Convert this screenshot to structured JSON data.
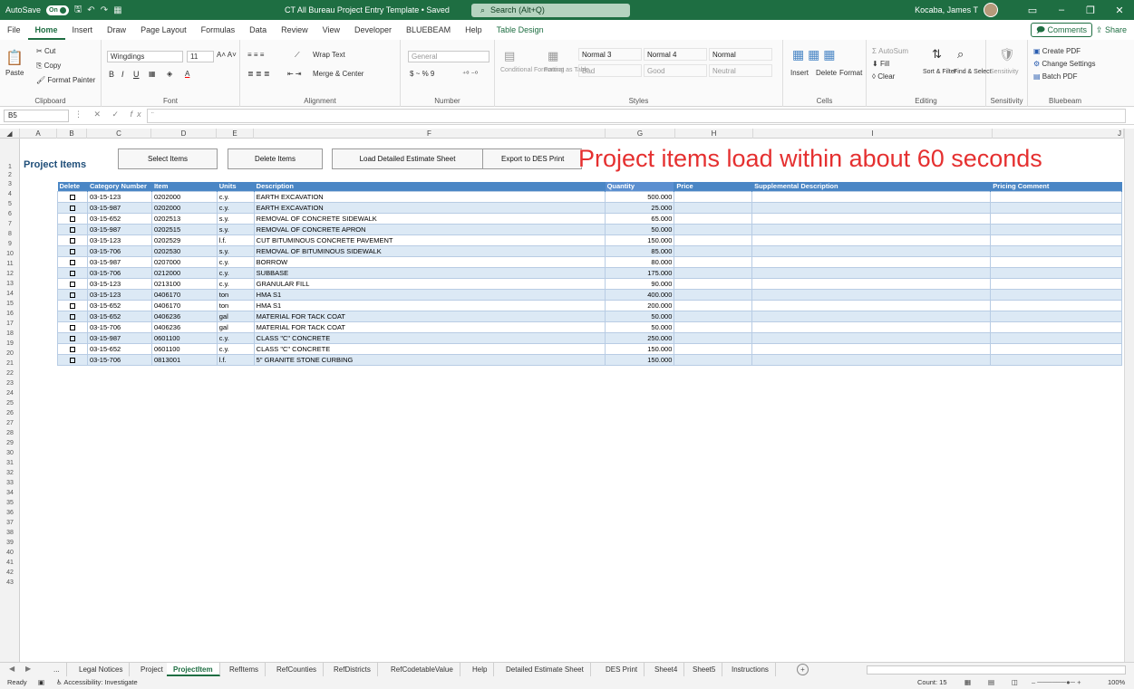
{
  "window": {
    "autosave_label": "AutoSave",
    "autosave_state": "On",
    "doc_title": "CT All Bureau Project Entry Template • Saved",
    "search_placeholder": "Search (Alt+Q)",
    "user_name": "Kocaba, James T",
    "minimize": "–",
    "restore": "❐",
    "close": "✕"
  },
  "menu": {
    "tabs": [
      "File",
      "Home",
      "Insert",
      "Draw",
      "Page Layout",
      "Formulas",
      "Data",
      "Review",
      "View",
      "Developer",
      "BLUEBEAM",
      "Help",
      "Table Design"
    ],
    "comments": "Comments",
    "share": "Share"
  },
  "ribbon": {
    "clipboard": {
      "label": "Clipboard",
      "paste": "Paste",
      "cut": "Cut",
      "copy": "Copy",
      "format_painter": "Format Painter"
    },
    "font": {
      "label": "Font",
      "name": "Wingdings",
      "size": "11"
    },
    "alignment": {
      "label": "Alignment",
      "wrap": "Wrap Text",
      "merge": "Merge & Center"
    },
    "number": {
      "label": "Number",
      "format": "General",
      "currency": "$ ~ % 9"
    },
    "styles": {
      "label": "Styles",
      "conditional": "Conditional Formatting",
      "format_as": "Format as Table",
      "items": [
        "Normal 3",
        "Normal 4",
        "Normal",
        "Bad",
        "Good",
        "Neutral"
      ]
    },
    "cells": {
      "label": "Cells",
      "insert": "Insert",
      "delete": "Delete",
      "format": "Format"
    },
    "editing": {
      "label": "Editing",
      "autosum": "AutoSum",
      "fill": "Fill",
      "clear": "Clear",
      "sort": "Sort & Filter",
      "find": "Find & Select"
    },
    "sensitivity": {
      "label": "Sensitivity",
      "btn": "Sensitivity"
    },
    "bluebeam": {
      "label": "Bluebeam",
      "create_pdf": "Create PDF",
      "change_settings": "Change Settings",
      "batch_pdf": "Batch PDF"
    }
  },
  "formula_bar": {
    "name_box": "B5",
    "fx": "fx",
    "content": "¨"
  },
  "columns": [
    "A",
    "B",
    "C",
    "D",
    "E",
    "F",
    "G",
    "H",
    "I",
    "J"
  ],
  "rows": [
    "1",
    "2",
    "3",
    "4",
    "5",
    "6",
    "7",
    "8",
    "9",
    "10",
    "11",
    "12",
    "13",
    "14",
    "15",
    "16",
    "17",
    "18",
    "19",
    "20",
    "21",
    "22",
    "23",
    "24",
    "25",
    "26",
    "27",
    "28",
    "29",
    "30",
    "31",
    "32",
    "33",
    "34",
    "35",
    "36",
    "37",
    "38",
    "39",
    "40",
    "41",
    "42",
    "43"
  ],
  "sheet": {
    "heading": "Project Items",
    "buttons": {
      "select_items": "Select Items",
      "delete_items": "Delete Items",
      "load_estimate": "Load Detailed Estimate Sheet",
      "export_des": "Export to DES Print"
    },
    "overlay_note": "Project items load within about 60 seconds",
    "table": {
      "headers": [
        "Delete",
        "Category Number",
        "Item",
        "Units",
        "Description",
        "Quantity",
        "Price",
        "Supplemental Description",
        "Pricing Comment"
      ],
      "rows": [
        [
          "03-15-123",
          "0202000",
          "c.y.",
          "EARTH EXCAVATION",
          "500.000"
        ],
        [
          "03-15-987",
          "0202000",
          "c.y.",
          "EARTH EXCAVATION",
          "25.000"
        ],
        [
          "03-15-652",
          "0202513",
          "s.y.",
          "REMOVAL OF CONCRETE SIDEWALK",
          "65.000"
        ],
        [
          "03-15-987",
          "0202515",
          "s.y.",
          "REMOVAL OF CONCRETE APRON",
          "50.000"
        ],
        [
          "03-15-123",
          "0202529",
          "l.f.",
          "CUT BITUMINOUS CONCRETE PAVEMENT",
          "150.000"
        ],
        [
          "03-15-706",
          "0202530",
          "s.y.",
          "REMOVAL OF BITUMINOUS SIDEWALK",
          "85.000"
        ],
        [
          "03-15-987",
          "0207000",
          "c.y.",
          "BORROW",
          "80.000"
        ],
        [
          "03-15-706",
          "0212000",
          "c.y.",
          "SUBBASE",
          "175.000"
        ],
        [
          "03-15-123",
          "0213100",
          "c.y.",
          "GRANULAR FILL",
          "90.000"
        ],
        [
          "03-15-123",
          "0406170",
          "ton",
          "HMA S1",
          "400.000"
        ],
        [
          "03-15-652",
          "0406170",
          "ton",
          "HMA S1",
          "200.000"
        ],
        [
          "03-15-652",
          "0406236",
          "gal",
          "MATERIAL FOR TACK COAT",
          "50.000"
        ],
        [
          "03-15-706",
          "0406236",
          "gal",
          "MATERIAL FOR TACK COAT",
          "50.000"
        ],
        [
          "03-15-987",
          "0601100",
          "c.y.",
          "CLASS \"C\" CONCRETE",
          "250.000"
        ],
        [
          "03-15-652",
          "0601100",
          "c.y.",
          "CLASS \"C\" CONCRETE",
          "150.000"
        ],
        [
          "03-15-706",
          "0813001",
          "l.f.",
          "5\" GRANITE STONE CURBING",
          "150.000"
        ]
      ]
    }
  },
  "sheet_tabs": [
    "...",
    "Legal Notices",
    "Project",
    "ProjectItem",
    "RefItems",
    "RefCounties",
    "RefDistricts",
    "RefCodetableValue",
    "Help",
    "Detailed Estimate Sheet",
    "DES Print",
    "Sheet4",
    "Sheet5",
    "Instructions"
  ],
  "active_tab": "ProjectItem",
  "status": {
    "ready": "Ready",
    "accessibility": "Accessibility: Investigate",
    "count": "Count: 15",
    "zoom": "100%"
  },
  "colors": {
    "accent": "#1e6e42",
    "table_header": "#4a86c5",
    "row_band": "#dce9f5",
    "overlay": "#e53030"
  }
}
